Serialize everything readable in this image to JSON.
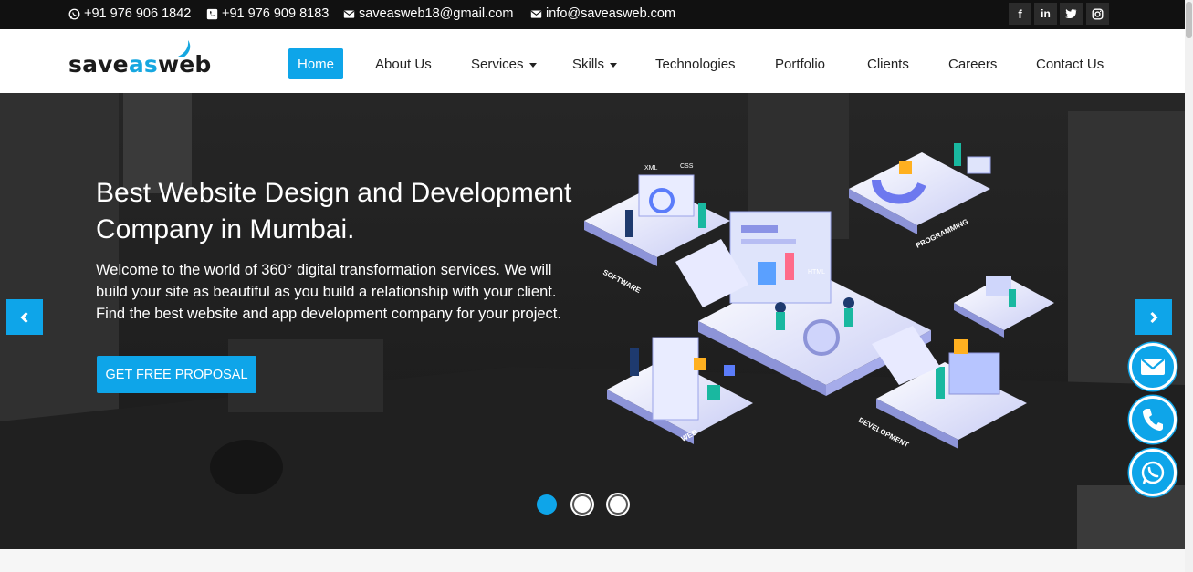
{
  "topbar": {
    "whatsapp_phone": "+91 976 906 1842",
    "phone": "+91 976 909 8183",
    "email1": "saveasweb18@gmail.com",
    "email2": "info@saveasweb.com",
    "social": [
      "f",
      "in",
      "twitter-icon",
      "instagram-icon"
    ]
  },
  "logo": {
    "part1": "save",
    "part2": "as",
    "part3": "web"
  },
  "nav": {
    "items": [
      "Home",
      "About Us",
      "Services",
      "Skills",
      "Technologies",
      "Portfolio",
      "Clients",
      "Careers",
      "Contact Us"
    ],
    "active": "Home"
  },
  "hero": {
    "title": "Best Website Design and Development Company in Mumbai.",
    "text": "Welcome to the world of 360° digital transformation services. We will build your site as beautiful as you build a relationship with your client. Find the best website and app development company for your project.",
    "cta_label": "GET FREE PROPOSAL",
    "slides": 3,
    "active_slide": 0,
    "illustration_labels": [
      "SOFTWARE",
      "PROGRAMMING",
      "WEB",
      "DEVELOPMENT",
      "XML",
      "CSS",
      "HTML"
    ]
  },
  "colors": {
    "accent": "#0ea5e9",
    "topbar": "#111111",
    "hero_bg": "#2a2a2a"
  },
  "floating": [
    "envelope-icon",
    "phone-icon",
    "whatsapp-icon"
  ]
}
